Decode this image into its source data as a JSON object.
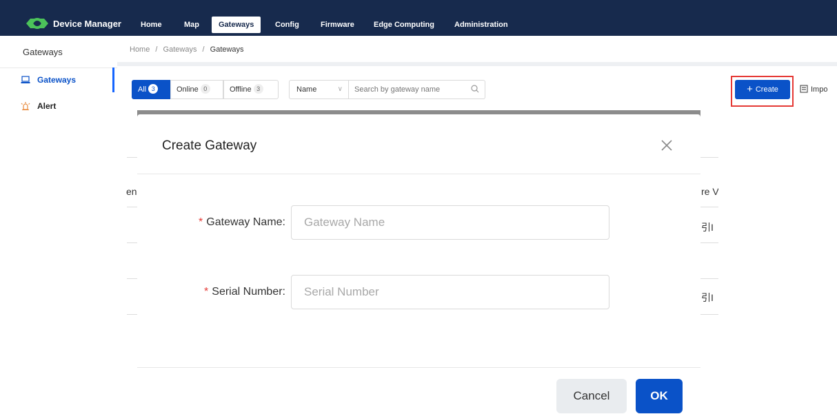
{
  "app": {
    "brand": "Device Manager"
  },
  "nav": [
    {
      "label": "Home"
    },
    {
      "label": "Map"
    },
    {
      "label": "Gateways"
    },
    {
      "label": "Config"
    },
    {
      "label": "Firmware"
    },
    {
      "label": "Edge Computing"
    },
    {
      "label": "Administration"
    }
  ],
  "sidebar": {
    "title": "Gateways",
    "items": [
      {
        "label": "Gateways",
        "icon": "laptop-icon"
      },
      {
        "label": "Alert",
        "icon": "alarm-icon"
      }
    ]
  },
  "breadcrumb": {
    "parts": [
      "Home",
      "Gateways",
      "Gateways"
    ],
    "sep": "/"
  },
  "filters": {
    "tabs": [
      {
        "label": "All",
        "count": "3"
      },
      {
        "label": "Online",
        "count": "0"
      },
      {
        "label": "Offline",
        "count": "3"
      }
    ],
    "field_select": "Name",
    "search_placeholder": "Search by gateway name"
  },
  "actions": {
    "create": "Create",
    "import": "Impo"
  },
  "background_fragments": {
    "col_left": "en",
    "col_right": "re V",
    "cell1": "引I",
    "cell2": "引I"
  },
  "modal": {
    "title": "Create Gateway",
    "fields": [
      {
        "label": "Gateway Name",
        "placeholder": "Gateway Name",
        "value": ""
      },
      {
        "label": "Serial Number",
        "placeholder": "Serial Number",
        "value": ""
      }
    ],
    "required_mark": "*",
    "colon": ":",
    "cancel": "Cancel",
    "ok": "OK"
  },
  "colors": {
    "header": "#172a4d",
    "primary": "#0a52c8",
    "highlight": "#e53935"
  }
}
